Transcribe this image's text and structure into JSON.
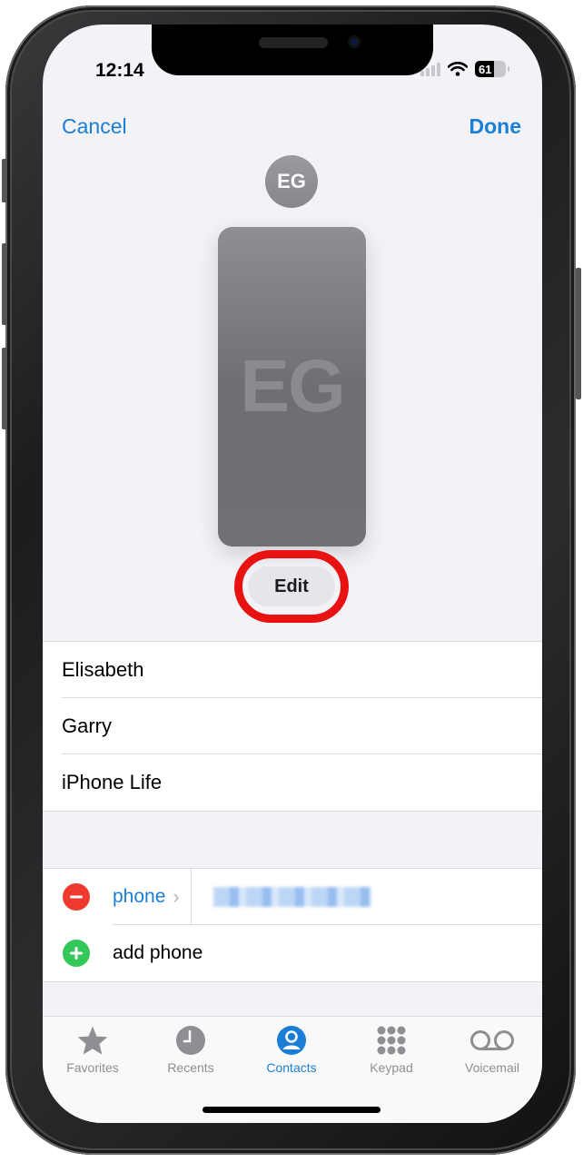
{
  "status_bar": {
    "time": "12:14",
    "battery": "61"
  },
  "nav": {
    "cancel_label": "Cancel",
    "done_label": "Done"
  },
  "contact": {
    "initials": "EG",
    "edit_label": "Edit",
    "first_name": "Elisabeth",
    "last_name": "Garry",
    "company": "iPhone Life"
  },
  "phone_section": {
    "phone_label": "phone",
    "phone_value": "(redacted)",
    "add_phone_label": "add phone"
  },
  "tabbar": {
    "tabs": [
      {
        "label": "Favorites",
        "icon": "star-icon",
        "active": false
      },
      {
        "label": "Recents",
        "icon": "clock-icon",
        "active": false
      },
      {
        "label": "Contacts",
        "icon": "person-circle-icon",
        "active": true
      },
      {
        "label": "Keypad",
        "icon": "keypad-icon",
        "active": false
      },
      {
        "label": "Voicemail",
        "icon": "voicemail-icon",
        "active": false
      }
    ]
  },
  "colors": {
    "accent": "#1a7fd4",
    "delete": "#f03a2e",
    "add": "#34c759",
    "highlight": "#e81212"
  }
}
